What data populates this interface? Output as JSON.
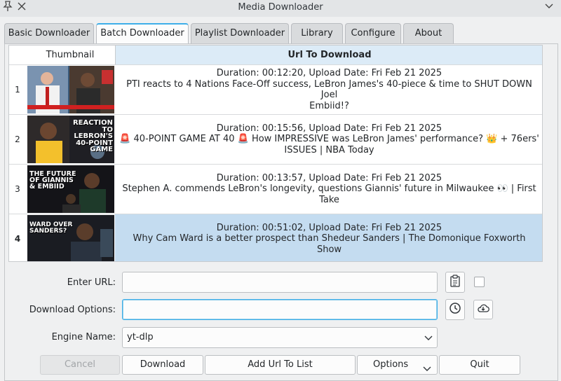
{
  "window": {
    "title": "Media Downloader"
  },
  "tabs": [
    {
      "label": "Basic Downloader",
      "active": false
    },
    {
      "label": "Batch Downloader",
      "active": true
    },
    {
      "label": "Playlist Downloader",
      "active": false
    },
    {
      "label": "Library",
      "active": false
    },
    {
      "label": "Configure",
      "active": false
    },
    {
      "label": "About",
      "active": false
    }
  ],
  "table": {
    "headers": {
      "thumbnail": "Thumbnail",
      "url": "Url To Download"
    },
    "rows": [
      {
        "index": "1",
        "line1": "Duration: 00:12:20, Upload Date: Fri Feb 21 2025",
        "line2": "PTI reacts to 4 Nations Face-Off success, LeBron James's 40-piece & time to SHUT DOWN Joel",
        "line3": "Embiid!?",
        "selected": false
      },
      {
        "index": "2",
        "line1": "Duration: 00:15:56, Upload Date: Fri Feb 21 2025",
        "line2": "🚨 40-POINT GAME AT 40 🚨 How IMPRESSIVE was LeBron James' performance? 👑 + 76ers'",
        "line3": "ISSUES | NBA Today",
        "selected": false,
        "thumb_text": "REACTION TO LEBRON'S 40-POINT GAME"
      },
      {
        "index": "3",
        "line1": "Duration: 00:13:57, Upload Date: Fri Feb 21 2025",
        "line2": "Stephen A. commends LeBron's longevity, questions Giannis' future in Milwaukee 👀 | First",
        "line3": "Take",
        "selected": false,
        "thumb_text": "THE FUTURE OF GIANNIS & EMBIID"
      },
      {
        "index": "4",
        "line1": "Duration: 00:51:02, Upload Date: Fri Feb 21 2025",
        "line2": "Why Cam Ward is a better prospect than Shedeur Sanders | The Domonique Foxworth Show",
        "line3": "",
        "selected": true,
        "thumb_text": "WARD OVER SANDERS?"
      }
    ]
  },
  "form": {
    "url_label": "Enter URL:",
    "url_value": "",
    "options_label": "Download Options:",
    "options_value": "",
    "engine_label": "Engine Name:",
    "engine_value": "yt-dlp"
  },
  "buttons": {
    "cancel": "Cancel",
    "download": "Download",
    "add_url": "Add Url To List",
    "options": "Options",
    "quit": "Quit"
  },
  "colors": {
    "accent": "#3daee9",
    "header_bg": "#dcebf7",
    "selected_row": "#c4dcf0"
  },
  "icons": [
    "pin-icon",
    "close-icon",
    "chevron-down-icon",
    "clipboard-icon",
    "history-icon",
    "cloud-download-icon"
  ]
}
